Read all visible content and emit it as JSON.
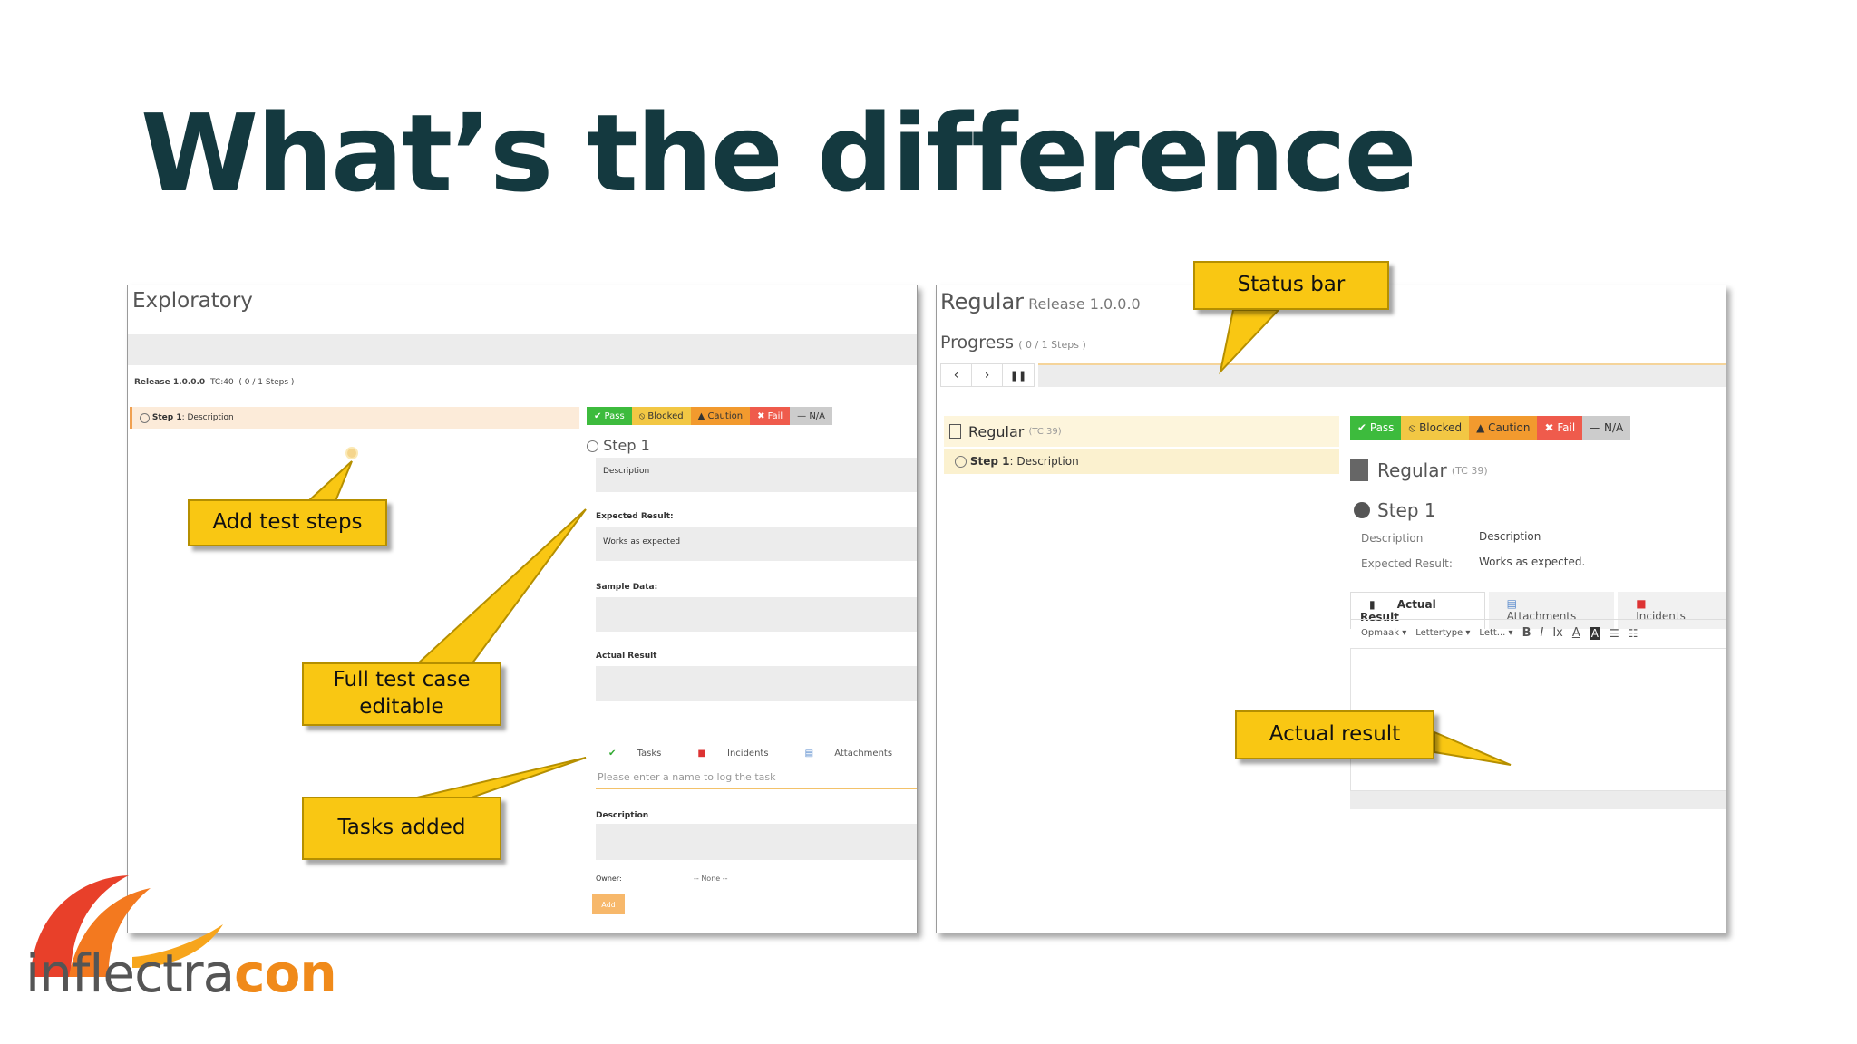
{
  "slide": {
    "title": "What’s the difference"
  },
  "logo": {
    "part1": "inflectra",
    "part2": "con"
  },
  "callouts": {
    "add_test_steps": "Add test steps",
    "full_test_case": "Full test case editable",
    "tasks_added": "Tasks added",
    "status_bar": "Status bar",
    "actual_result": "Actual result"
  },
  "exploratory": {
    "heading": "Exploratory",
    "release_info": "Release 1.0.0.0",
    "tc_info": "TC:40",
    "steps_info": "( 0 / 1 Steps )",
    "step_item": "Step 1",
    "step_item_desc": ": Description",
    "status_buttons": {
      "pass": "✔ Pass",
      "blocked": "⦸ Blocked",
      "caution": "▲ Caution",
      "fail": "✖ Fail",
      "na": "— N/A"
    },
    "step_title": "Step 1",
    "description_value": "Description",
    "expected_label": "Expected Result:",
    "expected_value": "Works as expected",
    "sample_label": "Sample Data:",
    "actual_label": "Actual Result",
    "tabs": {
      "tasks": "Tasks",
      "incidents": "Incidents",
      "attachments": "Attachments"
    },
    "task_placeholder": "Please enter a name to log the task",
    "description_label": "Description",
    "owner_label": "Owner:",
    "owner_value": "-- None --",
    "add_button": "Add"
  },
  "regular": {
    "heading": "Regular",
    "release": "Release 1.0.0.0",
    "progress_label": "Progress",
    "progress_steps": "( 0 / 1 Steps )",
    "tree_item": "Regular",
    "tree_item_tc": "(TC 39)",
    "tree_step": "Step 1",
    "tree_step_desc": ": Description",
    "status_buttons": {
      "pass": "✔ Pass",
      "blocked": "⦸ Blocked",
      "caution": "▲ Caution",
      "fail": "✖ Fail",
      "na": "— N/A"
    },
    "detail_title": "Regular",
    "detail_tc": "(TC 39)",
    "step_title": "Step 1",
    "desc_label": "Description",
    "desc_value": "Description",
    "expected_label": "Expected Result:",
    "expected_value": "Works as expected.",
    "tabs": {
      "actual": "Actual Result",
      "attachments": "Attachments",
      "incidents": "Incidents"
    },
    "toolbar": {
      "format": "Opmaak",
      "font": "Lettertype",
      "size": "Lett..."
    }
  }
}
